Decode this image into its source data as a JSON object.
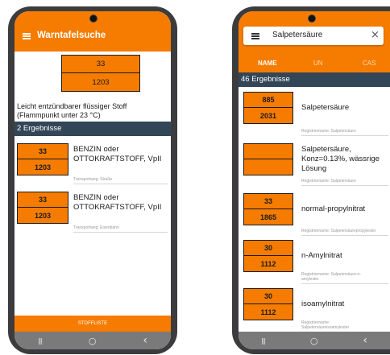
{
  "left": {
    "app_title": "Warntafelsuche",
    "plate": {
      "top": "33",
      "bottom": "1203"
    },
    "description": "Leicht entzündbarer flüssiger Stoff (Flammpunkt unter 23 °C)",
    "results_count": "2 Ergebnisse",
    "results": [
      {
        "un_top": "33",
        "un_bottom": "1203",
        "name": "BENZIN oder OTTOKRAFTSTOFF, VpII",
        "meta": "Transportweg: Straße"
      },
      {
        "un_top": "33",
        "un_bottom": "1203",
        "name": "BENZIN oder OTTOKRAFTSTOFF, VpII",
        "meta": "Transportweg: Eisenbahn"
      }
    ],
    "footer_button": "STOFFLISTE",
    "nav": {
      "recents": "|||",
      "home": "○",
      "back": "‹"
    }
  },
  "right": {
    "search_value": "Salpetersäure",
    "clear": "×",
    "tabs": [
      "NAME",
      "UN",
      "CAS"
    ],
    "active_tab": "NAME",
    "results_count": "46 Ergebnisse",
    "results": [
      {
        "un_top": "885",
        "un_bottom": "2031",
        "name": "Salpetersäure",
        "meta": "Registriername: Salpetersäure"
      },
      {
        "un_top": "",
        "un_bottom": "",
        "name": "Salpetersäure, Konz=0.13%, wässrige Lösung",
        "meta": "Registriername: Salpetersäure"
      },
      {
        "un_top": "33",
        "un_bottom": "1865",
        "name": "normal-propylnitrat",
        "meta": "Registriername: Salpetersäurepropylester"
      },
      {
        "un_top": "30",
        "un_bottom": "1112",
        "name": "n-Amylnitrat",
        "meta": "Registriername: Salpetersäure-n-amylester"
      },
      {
        "un_top": "30",
        "un_bottom": "1112",
        "name": "isoamylnitrat",
        "meta": "Registriername: Salpetersäureisoamylester"
      }
    ],
    "nav": {
      "recents": "|||",
      "home": "○",
      "back": "‹"
    }
  },
  "colors": {
    "accent": "#f57c00",
    "band": "#334657",
    "navbar": "#7a7a7a"
  }
}
